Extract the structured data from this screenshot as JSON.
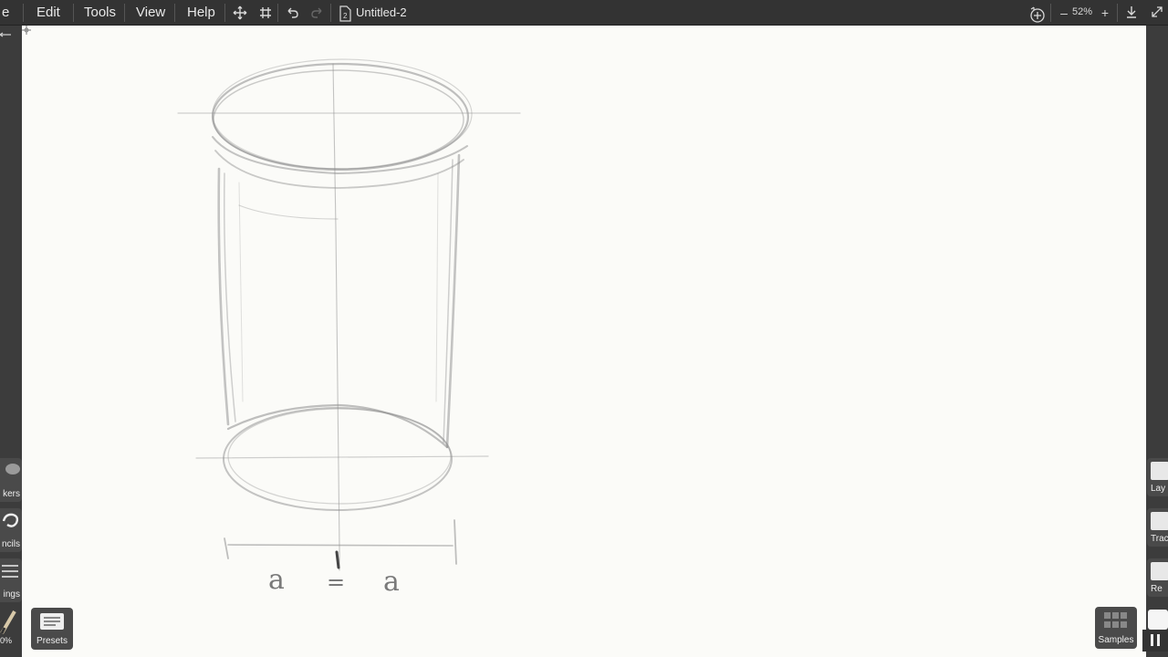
{
  "menubar": {
    "items": [
      {
        "label": "e"
      },
      {
        "label": "Edit"
      },
      {
        "label": "Tools"
      },
      {
        "label": "View"
      },
      {
        "label": "Help"
      }
    ],
    "icons": [
      "move-icon",
      "grid-icon",
      "undo-icon",
      "redo-icon",
      "document-icon"
    ]
  },
  "document": {
    "title": "Untitled-2",
    "page_number": "2"
  },
  "zoom": {
    "value": "52%",
    "minus": "–",
    "plus": "+"
  },
  "left_tools": [
    {
      "label": "kers",
      "icon": "markers-icon"
    },
    {
      "label": "ncils",
      "icon": "stencils-icon"
    },
    {
      "label": "ings",
      "icon": "settings-icon"
    }
  ],
  "brush_size": "0%",
  "right_tools": [
    {
      "label": "Lay",
      "icon": "layers-icon"
    },
    {
      "label": "Trac",
      "icon": "tracing-icon"
    },
    {
      "label": "Re",
      "icon": "reference-icon"
    }
  ],
  "bottom_buttons": {
    "presets": "Presets",
    "samples": "Samples"
  },
  "sketch": {
    "left_letter": "a",
    "equals": "=",
    "right_letter": "a"
  },
  "colors": {
    "paper": "#fbfbf8",
    "chrome": "#333333",
    "pencil": "#8a8a8a"
  }
}
